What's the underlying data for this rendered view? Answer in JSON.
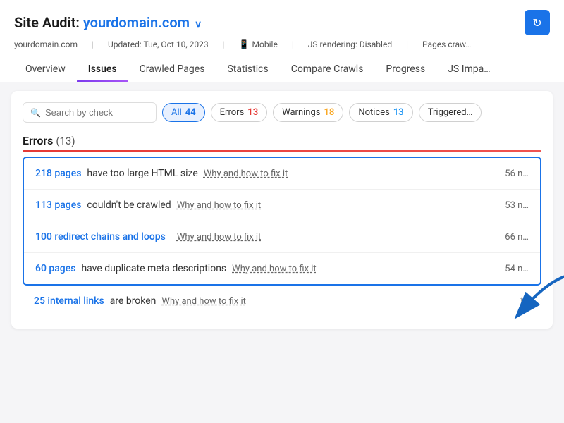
{
  "header": {
    "title_prefix": "Site Audit:",
    "domain": "yourdomain.com",
    "refresh_icon": "↻",
    "meta": [
      {
        "label": "yourdomain.com"
      },
      {
        "label": "Updated: Tue, Oct 10, 2023"
      },
      {
        "icon": "📱",
        "label": "Mobile"
      },
      {
        "label": "JS rendering: Disabled"
      },
      {
        "label": "Pages craw…"
      }
    ]
  },
  "nav": {
    "tabs": [
      {
        "id": "overview",
        "label": "Overview",
        "active": false
      },
      {
        "id": "issues",
        "label": "Issues",
        "active": true
      },
      {
        "id": "crawled-pages",
        "label": "Crawled Pages",
        "active": false
      },
      {
        "id": "statistics",
        "label": "Statistics",
        "active": false
      },
      {
        "id": "compare-crawls",
        "label": "Compare Crawls",
        "active": false
      },
      {
        "id": "progress",
        "label": "Progress",
        "active": false
      },
      {
        "id": "js-impact",
        "label": "JS Impa…",
        "active": false
      }
    ]
  },
  "filters": {
    "search_placeholder": "Search by check",
    "buttons": [
      {
        "id": "all",
        "label": "All",
        "count": "44",
        "active": true
      },
      {
        "id": "errors",
        "label": "Errors",
        "count": "13",
        "active": false,
        "type": "errors"
      },
      {
        "id": "warnings",
        "label": "Warnings",
        "count": "18",
        "active": false,
        "type": "warnings"
      },
      {
        "id": "notices",
        "label": "Notices",
        "count": "13",
        "active": false,
        "type": "notices"
      },
      {
        "id": "triggered",
        "label": "Triggered…",
        "count": "",
        "active": false
      }
    ]
  },
  "section": {
    "title": "Errors",
    "count": "(13)"
  },
  "issues": [
    {
      "id": "html-size",
      "link_text": "218 pages",
      "description": "have too large HTML size",
      "fix_label": "Why and how to fix it",
      "count": "56 n…",
      "highlighted": true
    },
    {
      "id": "crawl-error",
      "link_text": "113 pages",
      "description": "couldn't be crawled",
      "fix_label": "Why and how to fix it",
      "count": "53 n…",
      "highlighted": true,
      "has_arrow": true
    },
    {
      "id": "redirect-chains",
      "link_text": "100 redirect chains and loops",
      "description": "",
      "fix_label": "Why and how to fix it",
      "count": "66 n…",
      "highlighted": true
    },
    {
      "id": "duplicate-meta",
      "link_text": "60 pages",
      "description": "have duplicate meta descriptions",
      "fix_label": "Why and how to fix it",
      "count": "54 n…",
      "highlighted": true
    }
  ],
  "below_issues": [
    {
      "id": "broken-links",
      "link_text": "25 internal links",
      "description": "are broken",
      "fix_label": "Why and how to fix it",
      "count": "1…"
    }
  ]
}
